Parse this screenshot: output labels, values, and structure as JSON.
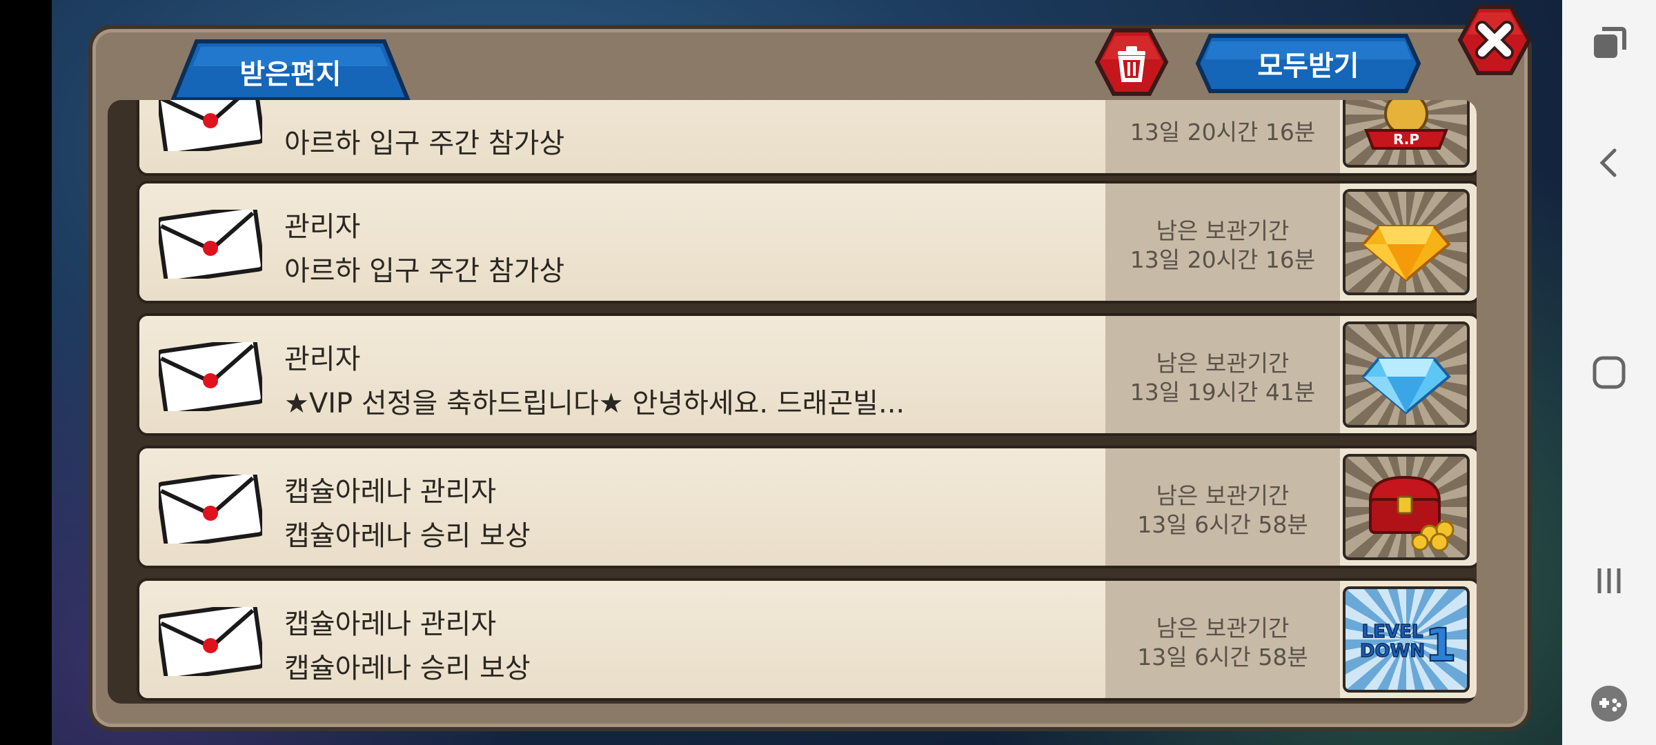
{
  "mailbox": {
    "tab_label": "받은편지",
    "trash_icon": "trash-icon",
    "receive_all_label": "모두받기",
    "close_icon": "close-icon"
  },
  "mails": [
    {
      "sender": "",
      "subject": "아르하 입구 주간 참가상",
      "expire_label": "",
      "expire_time": "13일 20시간 16분",
      "reward_icon": "rp-badge-icon"
    },
    {
      "sender": "관리자",
      "subject": "아르하 입구 주간 참가상",
      "expire_label": "남은 보관기간",
      "expire_time": "13일 20시간 16분",
      "reward_icon": "gold-gem-icon"
    },
    {
      "sender": "관리자",
      "subject": "★VIP 선정을 축하드립니다★ 안녕하세요. 드래곤빌...",
      "expire_label": "남은 보관기간",
      "expire_time": "13일 19시간 41분",
      "reward_icon": "blue-diamond-icon"
    },
    {
      "sender": "캡슐아레나 관리자",
      "subject": "캡슐아레나 승리 보상",
      "expire_label": "남은 보관기간",
      "expire_time": "13일 6시간 58분",
      "reward_icon": "treasure-chest-icon"
    },
    {
      "sender": "캡슐아레나 관리자",
      "subject": "캡슐아레나 승리 보상",
      "expire_label": "남은 보관기간",
      "expire_time": "13일 6시간 58분",
      "reward_icon": "level-down-icon"
    }
  ],
  "reward_text": {
    "rp": "R.P",
    "level": "LEVEL",
    "down": "DOWN",
    "one": "1"
  },
  "system_nav": {
    "icons": [
      "recent-apps-icon",
      "back-icon",
      "home-icon",
      "overview-icon",
      "game-tools-icon"
    ]
  },
  "colors": {
    "tab_blue": "#1565b8",
    "button_red": "#c4161c",
    "panel_brown": "#8b7a68",
    "row_cream": "#efe5d3",
    "envelope_dot": "#e0121e"
  }
}
